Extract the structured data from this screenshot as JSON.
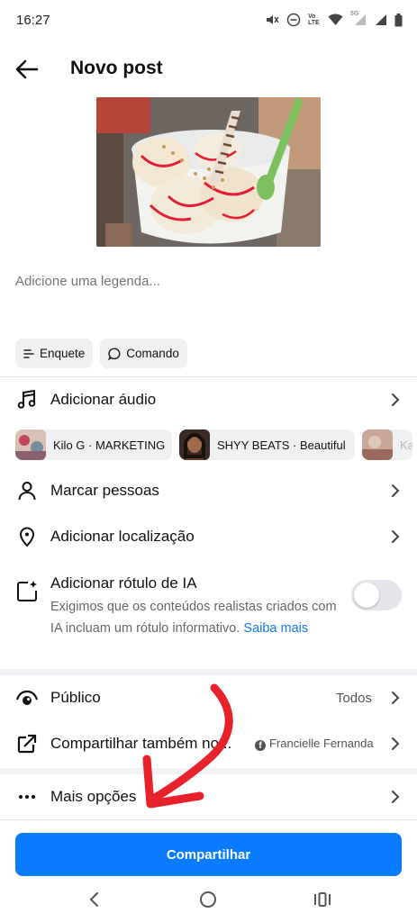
{
  "status_bar": {
    "time": "16:27",
    "icons": [
      "mute-icon",
      "dnd-icon",
      "volte-icon",
      "wifi-icon",
      "signal-5g-icon",
      "signal-icon",
      "battery-icon"
    ],
    "volte_label": "Vo LTE",
    "network_label": "5G"
  },
  "header": {
    "title": "Novo post",
    "back_icon": "arrow-left-icon"
  },
  "caption": {
    "placeholder": "Adicione uma legenda..."
  },
  "chips": [
    {
      "label": "Enquete",
      "icon": "poll-icon"
    },
    {
      "label": "Comando",
      "icon": "prompt-icon"
    }
  ],
  "options": {
    "audio": {
      "label": "Adicionar áudio",
      "icon": "music-note-icon"
    },
    "music_suggestions": [
      {
        "label": "Kilo G · MARKETING"
      },
      {
        "label": "SHYY BEATS · Beautiful"
      },
      {
        "label": "Ka"
      }
    ],
    "tag_people": {
      "label": "Marcar pessoas",
      "icon": "person-icon"
    },
    "location": {
      "label": "Adicionar localização",
      "icon": "location-pin-icon"
    },
    "ai_label": {
      "title": "Adicionar rótulo de IA",
      "description": "Exigimos que os conteúdos realistas criados com IA incluam um rótulo informativo.",
      "link": "Saiba mais",
      "enabled": false,
      "icon": "ai-label-icon"
    },
    "audience": {
      "label": "Público",
      "value": "Todos",
      "icon": "eye-icon"
    },
    "share_also": {
      "label": "Compartilhar também no...",
      "value": "Francielle Fernanda",
      "icon": "share-arrow-icon"
    },
    "more": {
      "label": "Mais opções",
      "icon": "more-dots-icon"
    }
  },
  "primary_action": {
    "label": "Compartilhar",
    "color": "#0a7cff"
  },
  "nav_bar": {
    "buttons": [
      "back-nav-icon",
      "home-nav-icon",
      "recents-nav-icon"
    ]
  },
  "colors": {
    "accent": "#0a7cff",
    "link": "#1877f2",
    "annotation": "#e8222a",
    "chip_bg": "#eef0f2"
  }
}
